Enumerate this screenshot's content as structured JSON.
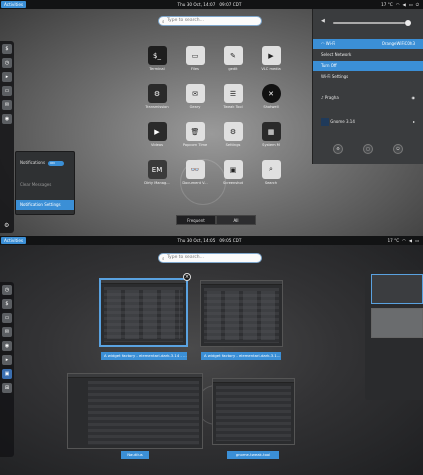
{
  "top": {
    "activities": "Activities",
    "clock": "Thu 30 Oct, 14:07",
    "tz": "09:07 CDT",
    "tray": [
      "17 °C",
      "wifi-icon",
      "volume-icon",
      "battery-icon",
      "power-icon"
    ]
  },
  "search_top": {
    "placeholder": "Type to search..."
  },
  "dash_top": {
    "items": [
      "terminal-icon",
      "clock-icon",
      "terminal-icon",
      "files-icon",
      "chat-icon",
      "camera-icon"
    ]
  },
  "apps": [
    {
      "label": "Terminal",
      "glyph": "$_"
    },
    {
      "label": "Files",
      "glyph": "▭"
    },
    {
      "label": "gedit",
      "glyph": "✎"
    },
    {
      "label": "VLC media",
      "glyph": "▶"
    },
    {
      "label": "Transmission",
      "glyph": "⚙"
    },
    {
      "label": "Geary",
      "glyph": "✉"
    },
    {
      "label": "Tweak Tool",
      "glyph": "☰"
    },
    {
      "label": "Shotwell",
      "glyph": "✕"
    },
    {
      "label": "Videos",
      "glyph": "▶"
    },
    {
      "label": "Popcorn Time",
      "glyph": "🗑"
    },
    {
      "label": "Settings",
      "glyph": "⚙"
    },
    {
      "label": "System M",
      "glyph": "▦"
    },
    {
      "label": "Dirty Manag...",
      "glyph": "EM"
    },
    {
      "label": "Document V...",
      "glyph": "👓"
    },
    {
      "label": "Screenshot",
      "glyph": "▣"
    },
    {
      "label": "Search",
      "glyph": "⌕"
    }
  ],
  "seg": {
    "frequent": "Frequent",
    "all": "All"
  },
  "notif_popup": {
    "title": "Notifications",
    "toggle": "ON",
    "items": [
      "Clear Messages",
      "Notification Settings"
    ]
  },
  "sysmenu": {
    "wifi": "Wi-Fi",
    "network": "OrangeWiFiC0h3",
    "items": [
      "Select Network",
      "Turn Off",
      "Wi-Fi Settings"
    ],
    "user": "Pragha",
    "gnome": "Gnome 3.14",
    "buttons": [
      "settings-icon",
      "lock-icon",
      "power-icon"
    ]
  },
  "bottom": {
    "activities": "Activities",
    "clock": "Thu 30 Oct, 14:05",
    "tz": "09:05 CDT",
    "tray": [
      "17 °C",
      "wifi-icon",
      "volume-icon",
      "battery-icon"
    ]
  },
  "search_bottom": {
    "placeholder": "Type to search..."
  },
  "windows": [
    {
      "caption": "A widget factory - elementari-dark-3.14 - ..."
    },
    {
      "caption": "A widget factory - elementari-dark-3.1..."
    },
    {
      "caption": "Nautilus"
    },
    {
      "caption": "gnome-tweak-tool"
    }
  ]
}
